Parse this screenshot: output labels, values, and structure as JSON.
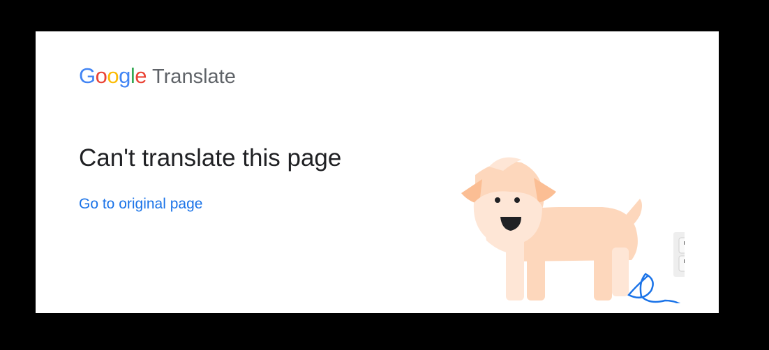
{
  "logo": {
    "letters": [
      "G",
      "o",
      "o",
      "g",
      "l",
      "e"
    ],
    "letter_colors": [
      "#4285F4",
      "#EA4335",
      "#FBBC05",
      "#4285F4",
      "#34A853",
      "#EA4335"
    ],
    "product": "Translate"
  },
  "error": {
    "title": "Can't translate this page",
    "link_label": "Go to original page"
  },
  "illustration": {
    "subject": "unplugged-dog",
    "dog_color": "#FDD7BC",
    "cord_color": "#1A73E8"
  },
  "colors": {
    "background": "#000000",
    "card": "#FFFFFF",
    "title": "#202124",
    "link": "#1A73E8",
    "product_text": "#5F6368"
  }
}
